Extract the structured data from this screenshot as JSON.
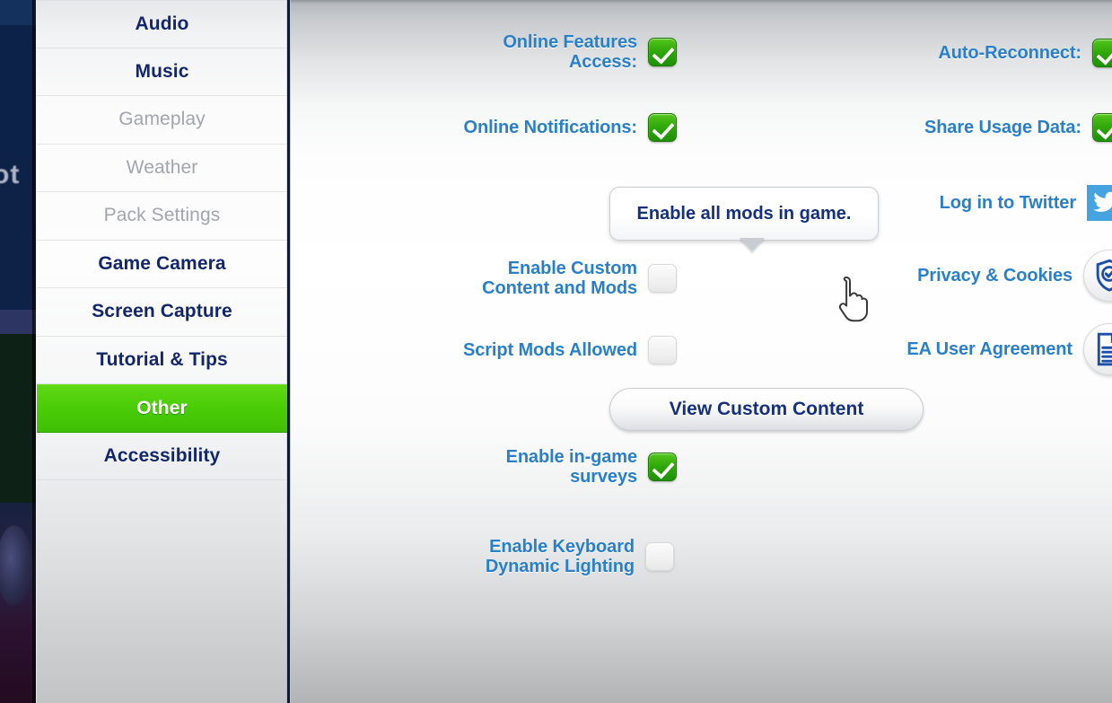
{
  "backdrop": {
    "text_fragment": "ot"
  },
  "sidebar": {
    "items": [
      {
        "label": "Audio",
        "state": "enabled"
      },
      {
        "label": "Music",
        "state": "enabled"
      },
      {
        "label": "Gameplay",
        "state": "disabled"
      },
      {
        "label": "Weather",
        "state": "disabled"
      },
      {
        "label": "Pack Settings",
        "state": "disabled"
      },
      {
        "label": "Game Camera",
        "state": "enabled"
      },
      {
        "label": "Screen Capture",
        "state": "enabled"
      },
      {
        "label": "Tutorial & Tips",
        "state": "enabled"
      },
      {
        "label": "Other",
        "state": "active"
      },
      {
        "label": "Accessibility",
        "state": "enabled"
      }
    ]
  },
  "main": {
    "left_column": {
      "online_features_access": {
        "label": "Online Features Access:",
        "line1": "Online Features",
        "line2": "Access:",
        "checked": true
      },
      "online_notifications": {
        "label": "Online Notifications:",
        "checked": true
      },
      "enable_custom_content": {
        "line1": "Enable Custom",
        "line2": "Content and Mods",
        "checked": false
      },
      "script_mods_allowed": {
        "label": "Script Mods Allowed",
        "checked": false
      },
      "view_custom_content": {
        "label": "View Custom Content"
      },
      "enable_ingame_surveys": {
        "line1": "Enable in-game",
        "line2": "surveys",
        "checked": true
      },
      "enable_keyboard_lighting": {
        "line1": "Enable Keyboard",
        "line2": "Dynamic Lighting",
        "checked": false
      }
    },
    "right_column": {
      "auto_reconnect": {
        "label": "Auto-Reconnect:",
        "checked": true
      },
      "share_usage_data": {
        "label": "Share Usage Data:",
        "checked": true
      },
      "log_in_to_twitter": {
        "label": "Log in to Twitter",
        "icon": "twitter-icon"
      },
      "privacy_cookies": {
        "label": "Privacy & Cookies",
        "icon": "shield-check-icon"
      },
      "ea_user_agreement": {
        "label": "EA User Agreement",
        "icon": "document-icon"
      }
    },
    "tooltip": {
      "text": "Enable all mods in game."
    }
  },
  "cursor": {
    "type": "pointing-hand-cursor"
  },
  "colors": {
    "accent_green": "#3fbf04",
    "label_blue": "#2a7fc9",
    "title_navy": "#14307e",
    "twitter_blue": "#45a3e0"
  }
}
